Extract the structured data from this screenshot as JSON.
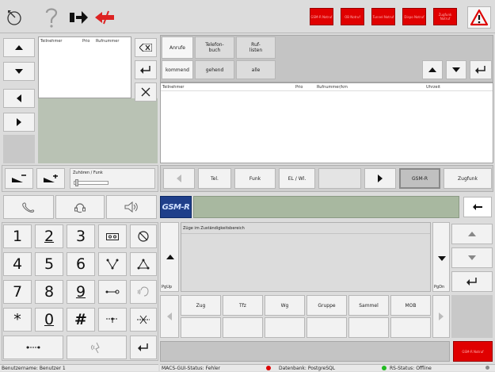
{
  "toolbar": {
    "alarm_buttons": [
      {
        "label": "GSM-R Notruf"
      },
      {
        "label": "OB Notruf"
      },
      {
        "label": "Tunnel Notruf"
      },
      {
        "label": "Dispo Notruf"
      },
      {
        "label": "Zugfunk Notruf"
      }
    ],
    "icons": [
      "hangup-dial-icon",
      "help-icon",
      "forward-arrow-icon",
      "redirect-cancel-icon",
      "warning-icon"
    ]
  },
  "participants": {
    "headers": [
      "Teilnehmer",
      "Prio",
      "Rufnummer"
    ]
  },
  "volume": {
    "label": "Zuhören / Funk"
  },
  "tabs": {
    "top": [
      "Anrufe",
      "Telefon-\nbuch",
      "Ruf-\nlisten"
    ],
    "bottom": [
      "kommend",
      "gehend",
      "alle"
    ],
    "table_headers": [
      "Teilnehmer",
      "Prio",
      "Rufnummer/km",
      "Uhrzeit"
    ]
  },
  "filter_bar": {
    "items": [
      "Tel.",
      "Funk",
      "EL / Wl.",
      "GSM-R",
      "Zugfunk"
    ]
  },
  "gsmr_logo": "GSM-R",
  "trains": {
    "title": "Züge im Zuständigkeitsbereich",
    "pgup": "PgUp",
    "pgdn": "PgDn",
    "categories": [
      "Zug",
      "Tfz",
      "Wg",
      "Gruppe",
      "Sammel",
      "MOB"
    ]
  },
  "keypad": {
    "keys": [
      "1",
      "2",
      "3",
      "4",
      "5",
      "6",
      "7",
      "8",
      "9",
      "*",
      "0",
      "#"
    ]
  },
  "bottom_alarm": "GSM-R Notruf",
  "status": {
    "user": "Benutzername: Benutzer 1",
    "gui": "MACS-GUI-Status: Fehler",
    "db": "Datenbank: PostgreSQL",
    "rs": "RS-Status: Offline"
  },
  "colors": {
    "alarm_red": "#e00000",
    "status_red": "#dd0000",
    "status_green": "#22bb22",
    "gsmr_blue": "#1f3f8a",
    "field_green": "#a8b8a0"
  }
}
